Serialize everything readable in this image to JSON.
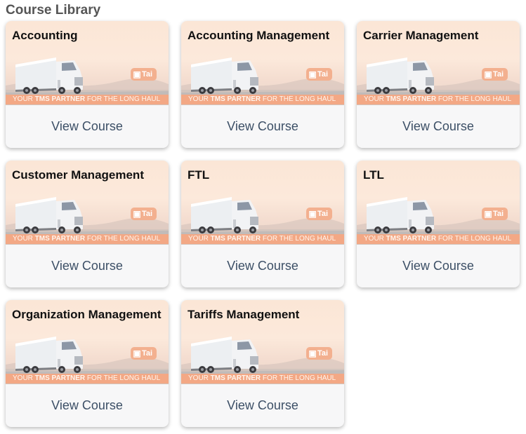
{
  "page": {
    "title": "Course Library"
  },
  "banner": {
    "tagline_pre": "YOUR ",
    "tagline_bold": "TMS PARTNER",
    "tagline_post": " FOR THE LONG HAUL",
    "logo_text": "Tai",
    "logo_icon": "tai-logo-icon"
  },
  "courses": [
    {
      "title": "Accounting",
      "link": "View Course"
    },
    {
      "title": "Accounting Management",
      "link": "View Course"
    },
    {
      "title": "Carrier Management",
      "link": "View Course"
    },
    {
      "title": "Customer Management",
      "link": "View Course"
    },
    {
      "title": "FTL",
      "link": "View Course"
    },
    {
      "title": "LTL",
      "link": "View Course"
    },
    {
      "title": "Organization Management",
      "link": "View Course"
    },
    {
      "title": "Tariffs Management",
      "link": "View Course"
    }
  ],
  "colors": {
    "link": "#3c4f66",
    "tagline_bg": "#f3a885",
    "title": "#555555"
  }
}
